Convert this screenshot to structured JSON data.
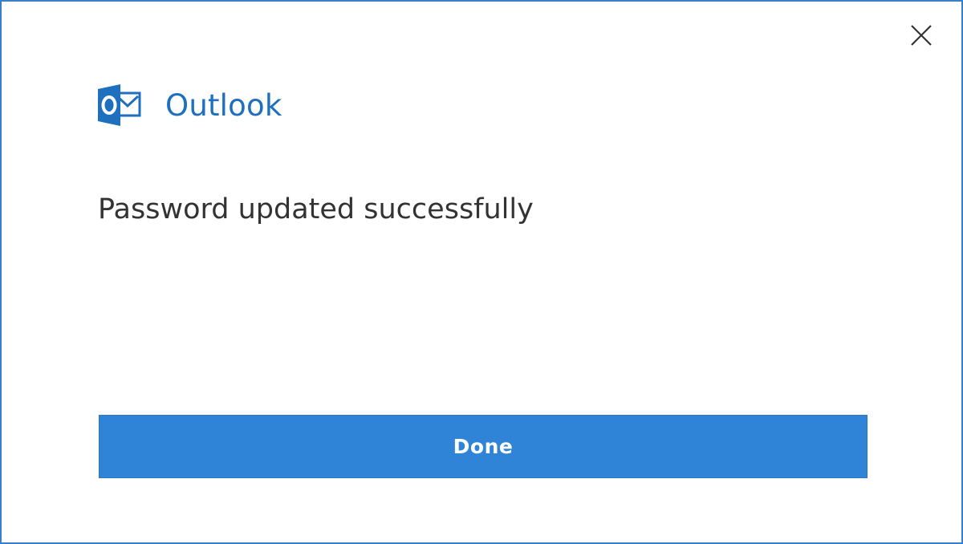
{
  "dialog": {
    "app_name": "Outlook",
    "message": "Password updated successfully",
    "done_label": "Done",
    "close_icon": "close-icon",
    "logo_icon": "outlook-logo-icon"
  },
  "colors": {
    "accent": "#2f84d7",
    "brand_text": "#1f6fbf",
    "border": "#3a80c8",
    "message_text": "#333333"
  }
}
